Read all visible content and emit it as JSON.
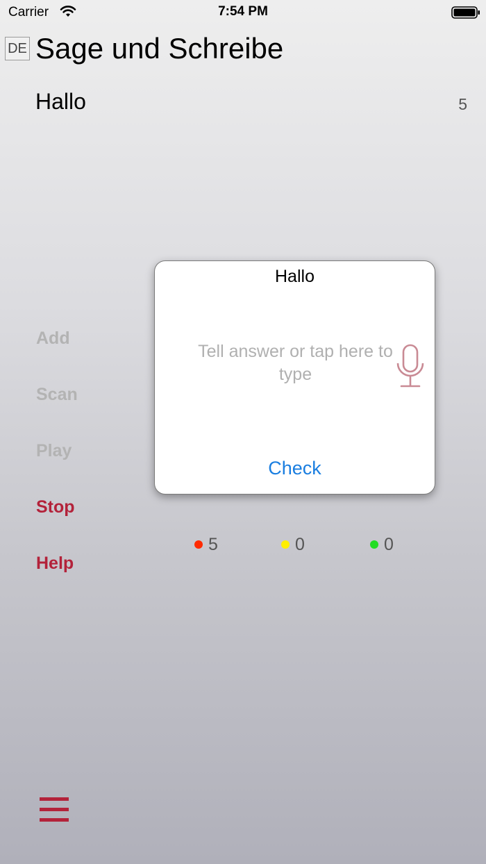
{
  "status_bar": {
    "carrier": "Carrier",
    "time": "7:54 PM",
    "wifi_icon": "wifi-icon",
    "battery_icon": "battery-icon"
  },
  "header": {
    "language": "DE",
    "title": "Sage und Schreibe"
  },
  "word": {
    "text": "Hallo",
    "count": "5"
  },
  "menu": {
    "items": [
      {
        "label": "Add",
        "state": "disabled"
      },
      {
        "label": "Scan",
        "state": "disabled"
      },
      {
        "label": "Play",
        "state": "disabled"
      },
      {
        "label": "Stop",
        "state": "active"
      },
      {
        "label": "Help",
        "state": "active"
      }
    ],
    "hamburger_icon": "hamburger-icon"
  },
  "dialog": {
    "title": "Hallo",
    "placeholder": "Tell answer or tap here to type",
    "mic_icon": "microphone-icon",
    "check_label": "Check"
  },
  "stats": [
    {
      "name": "red",
      "color": "#ff2a00",
      "value": "5"
    },
    {
      "name": "yellow",
      "color": "#ffee00",
      "value": "0"
    },
    {
      "name": "green",
      "color": "#22dd22",
      "value": "0"
    }
  ],
  "colors": {
    "accent": "#b3223a",
    "link": "#1a7ee0",
    "disabled": "#b3b3b3",
    "mic": "#c98a94"
  }
}
